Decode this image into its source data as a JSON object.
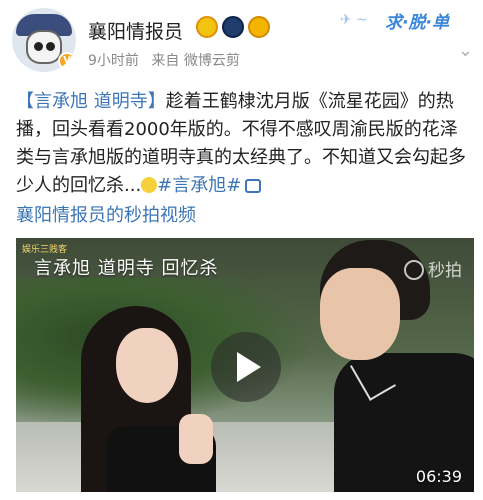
{
  "header": {
    "username": "襄阳情报员",
    "time": "9小时前",
    "source": "来自 微博云剪",
    "logo_text": "求·脱·单",
    "chevron": "⌄"
  },
  "post": {
    "topic_prefix": "【言承旭 道明寺】",
    "body": "趁着王鹤棣沈月版《流星花园》的热播，回头看看2000年版的。不得不感叹周渝民版的花泽类与言承旭版的道明寺真的太经典了。不知道又会勾起多少人的回忆杀...",
    "hashtag": "#言承旭#",
    "video_link": "襄阳情报员的秒拍视频"
  },
  "video": {
    "channel_tag": "娱乐三贱客",
    "caption": "言承旭 道明寺 回忆杀",
    "watermark": "秒拍",
    "duration": "06:39"
  },
  "icons": {
    "avatar_badge": "vip-badge-icon",
    "link": "video-link-icon",
    "play": "play-icon"
  },
  "colors": {
    "link": "#3d76b6",
    "meta": "#8a8a8a",
    "text": "#222222"
  }
}
